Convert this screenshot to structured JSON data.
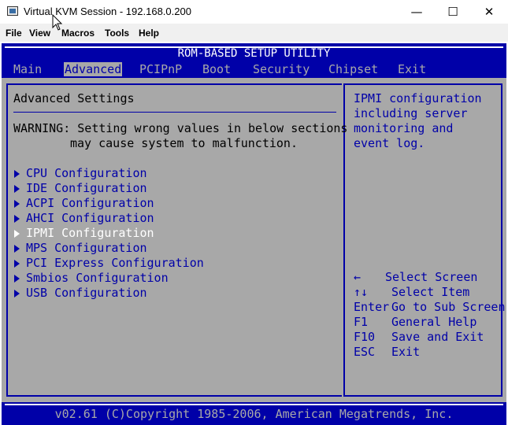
{
  "window": {
    "title": "Virtual KVM Session - 192.168.0.200",
    "minimize": "—",
    "maximize": "☐",
    "close": "✕"
  },
  "menubar": [
    "File",
    "View",
    "Macros",
    "Tools",
    "Help"
  ],
  "bios": {
    "title": "ROM-BASED SETUP UTILITY",
    "tabs": [
      "Main",
      "Advanced",
      "PCIPnP",
      "Boot",
      "Security",
      "Chipset",
      "Exit"
    ],
    "active_tab": "Advanced",
    "section_title": "Advanced Settings",
    "warning_line1": "WARNING: Setting wrong values in below sections",
    "warning_line2": "may cause system to malfunction.",
    "items": [
      "CPU Configuration",
      "IDE Configuration",
      "ACPI Configuration",
      "AHCI Configuration",
      "IPMI Configuration",
      "MPS Configuration",
      "PCI Express Configuration",
      "Smbios Configuration",
      "USB Configuration"
    ],
    "selected_item": "IPMI Configuration",
    "help_text": [
      "IPMI configuration",
      "including server",
      "monitoring and",
      "event log."
    ],
    "keys": [
      {
        "key": "←",
        "desc": "Select Screen"
      },
      {
        "key": "↑↓",
        "desc": "Select Item"
      },
      {
        "key": "Enter",
        "desc": "Go to Sub Screen"
      },
      {
        "key": "F1",
        "desc": "General Help"
      },
      {
        "key": "F10",
        "desc": "Save and Exit"
      },
      {
        "key": "ESC",
        "desc": "Exit"
      }
    ],
    "copyright": "v02.61 (C)Copyright 1985-2006, American Megatrends, Inc."
  },
  "colors": {
    "bios_blue": "#0000a8",
    "bios_gray": "#a8a8a8",
    "highlight": "#ffffff"
  }
}
